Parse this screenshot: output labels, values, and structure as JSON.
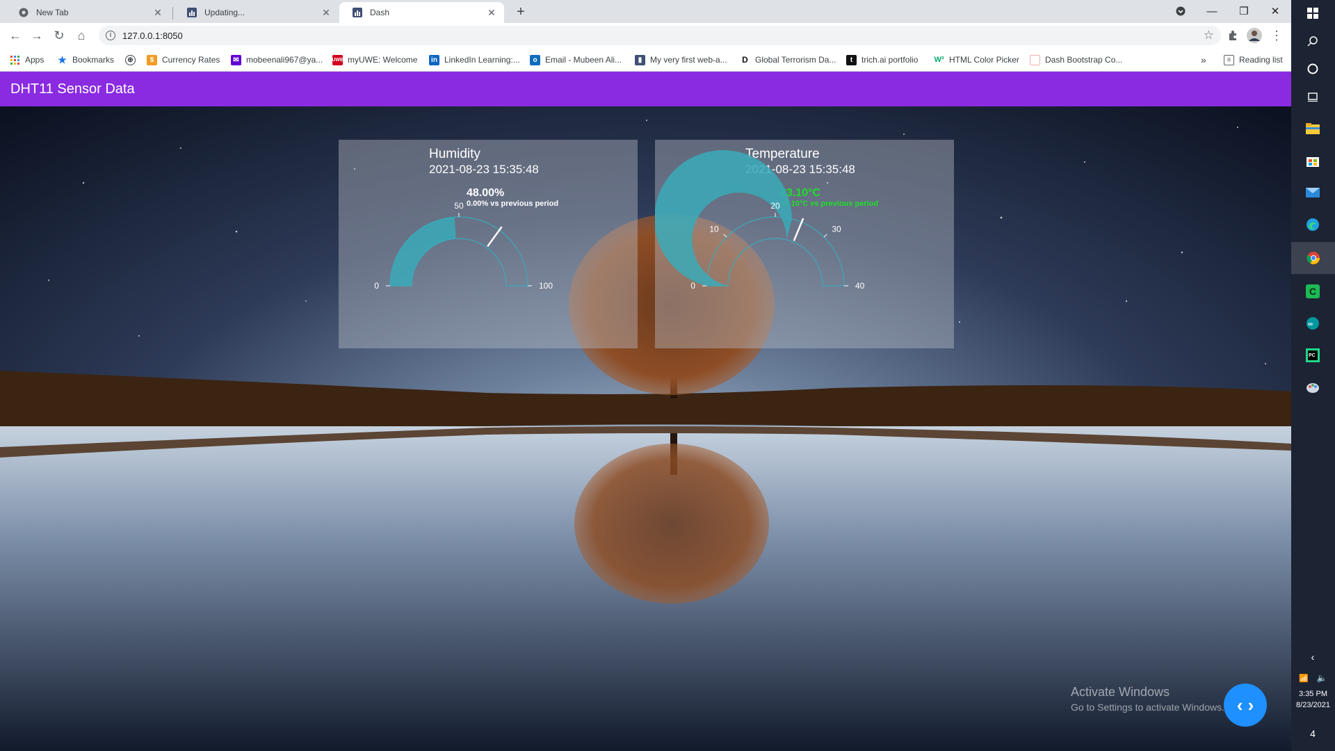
{
  "browser": {
    "tabs": [
      {
        "title": "New Tab",
        "icon": "chrome-icon"
      },
      {
        "title": "Updating...",
        "icon": "dash-app-icon"
      },
      {
        "title": "Dash",
        "icon": "dash-app-icon"
      }
    ],
    "active_tab": 2,
    "url": "127.0.0.1:8050"
  },
  "bookmarks": {
    "items": [
      {
        "label": "Apps",
        "icon": "apps-grid-icon"
      },
      {
        "label": "Bookmarks",
        "icon": "star-icon"
      },
      {
        "label": "",
        "icon": "globe-icon"
      },
      {
        "label": "Currency Rates",
        "icon": "currency-icon"
      },
      {
        "label": "mobeenali967@ya...",
        "icon": "yahoo-mail-icon"
      },
      {
        "label": "myUWE: Welcome",
        "icon": "uwe-icon"
      },
      {
        "label": "LinkedIn Learning:...",
        "icon": "linkedin-icon"
      },
      {
        "label": "Email - Mubeen Ali...",
        "icon": "outlook-icon"
      },
      {
        "label": "My very first web-a...",
        "icon": "dash-app-icon"
      },
      {
        "label": "Global Terrorism Da...",
        "icon": "letter-d-icon"
      },
      {
        "label": "trich.ai portfolio",
        "icon": "letter-t-icon"
      },
      {
        "label": "HTML Color Picker",
        "icon": "w3-icon"
      },
      {
        "label": "Dash Bootstrap Co...",
        "icon": "page-icon"
      }
    ],
    "more": "»",
    "reading_list": "Reading list"
  },
  "app": {
    "title": "DHT11 Sensor Data"
  },
  "cards": [
    {
      "title": "Humidity",
      "timestamp": "2021-08-23 15:35:48",
      "value_text": "48.00%",
      "delta_text": "0.00% vs previous period"
    },
    {
      "title": "Temperature",
      "timestamp": "2021-08-23 15:35:48",
      "value_text": "23.10°C",
      "delta_text": "+0.10°C vs previous period"
    }
  ],
  "chart_data": [
    {
      "type": "gauge",
      "title": "Humidity",
      "value": 48,
      "unit": "%",
      "range": [
        0,
        100
      ],
      "ticks": [
        0,
        50,
        100
      ],
      "threshold": 70,
      "bar_color": "#3aaab8",
      "delta_color": "#ffffff"
    },
    {
      "type": "gauge",
      "title": "Temperature",
      "value": 23.1,
      "unit": "°C",
      "range": [
        0,
        40
      ],
      "ticks": [
        0,
        10,
        20,
        30,
        40
      ],
      "threshold": 25,
      "bar_color": "#3aaab8",
      "delta_color": "#1ee02a"
    }
  ],
  "watermark": {
    "line1": "Activate Windows",
    "line2": "Go to Settings to activate Windows."
  },
  "taskbar": {
    "time": "3:35 PM",
    "date": "8/23/2021",
    "notifications": "4"
  }
}
